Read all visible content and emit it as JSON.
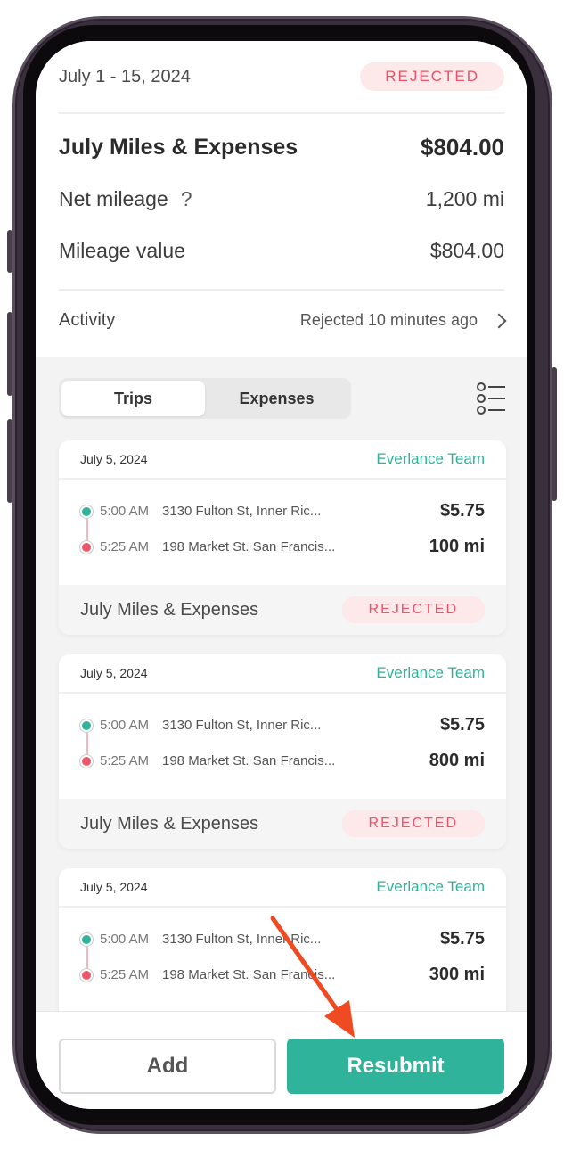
{
  "summary": {
    "date_range": "July 1 - 15, 2024",
    "status": "REJECTED",
    "title": "July Miles & Expenses",
    "total": "$804.00",
    "net_mileage_label": "Net mileage",
    "net_mileage_help": "?",
    "net_mileage_value": "1,200 mi",
    "mileage_value_label": "Mileage value",
    "mileage_value": "$804.00",
    "activity_label": "Activity",
    "activity_value": "Rejected 10 minutes ago"
  },
  "tabs": [
    {
      "label": "Trips",
      "active": true
    },
    {
      "label": "Expenses",
      "active": false
    }
  ],
  "cards": [
    {
      "date": "July 5, 2024",
      "team": "Everlance Team",
      "start_time": "5:00 AM",
      "start_addr": "3130 Fulton St, Inner Ric...",
      "amount": "$5.75",
      "end_time": "5:25 AM",
      "end_addr": "198 Market St. San Francis...",
      "distance": "100 mi",
      "report": "July Miles & Expenses",
      "status": "REJECTED"
    },
    {
      "date": "July 5, 2024",
      "team": "Everlance Team",
      "start_time": "5:00 AM",
      "start_addr": "3130 Fulton St, Inner Ric...",
      "amount": "$5.75",
      "end_time": "5:25 AM",
      "end_addr": "198 Market St. San Francis...",
      "distance": "800 mi",
      "report": "July Miles & Expenses",
      "status": "REJECTED"
    },
    {
      "date": "July 5, 2024",
      "team": "Everlance Team",
      "start_time": "5:00 AM",
      "start_addr": "3130 Fulton St, Inner Ric...",
      "amount": "$5.75",
      "end_time": "5:25 AM",
      "end_addr": "198 Market St. San Francis...",
      "distance": "300 mi"
    }
  ],
  "actions": {
    "add_label": "Add",
    "resubmit_label": "Resubmit"
  },
  "colors": {
    "accent": "#2fb39a",
    "rejected": "#e8546a",
    "annotation_arrow": "#f04a23"
  }
}
